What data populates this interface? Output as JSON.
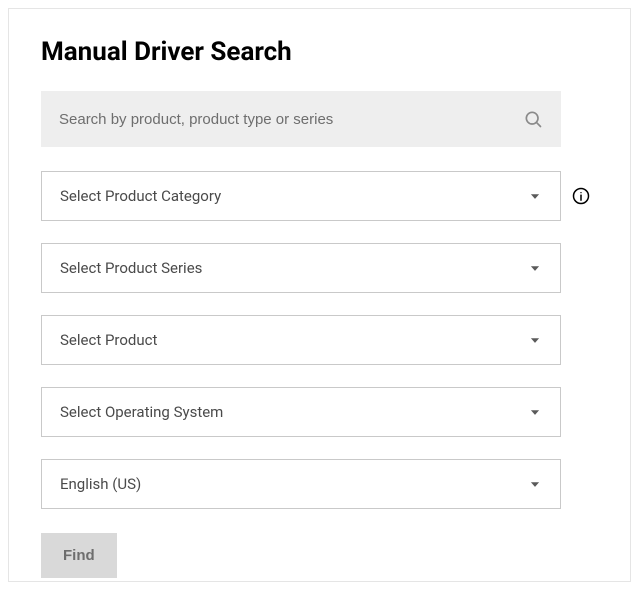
{
  "title": "Manual Driver Search",
  "search": {
    "placeholder": "Search by product, product type or series"
  },
  "selects": {
    "product_category": "Select Product Category",
    "product_series": "Select Product Series",
    "product": "Select Product",
    "operating_system": "Select Operating System",
    "language": "English (US)"
  },
  "buttons": {
    "find": "Find"
  }
}
